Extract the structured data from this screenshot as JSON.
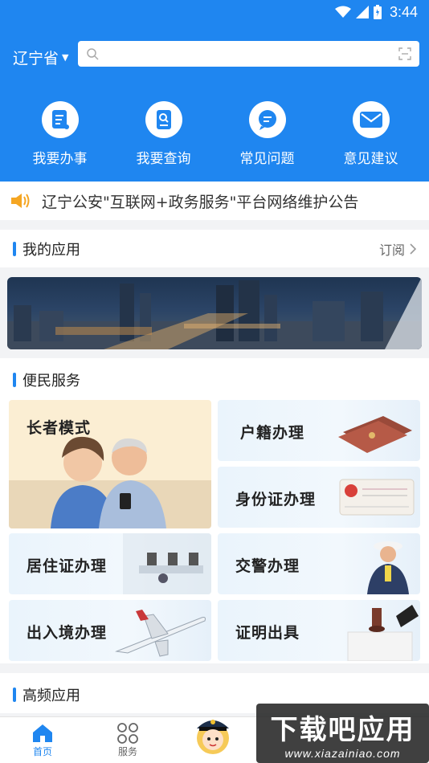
{
  "status_bar": {
    "time": "3:44"
  },
  "header": {
    "province": "辽宁省",
    "search_placeholder": "",
    "quick_actions": [
      {
        "label": "我要办事",
        "icon": "document-icon"
      },
      {
        "label": "我要查询",
        "icon": "search-doc-icon"
      },
      {
        "label": "常见问题",
        "icon": "chat-icon"
      },
      {
        "label": "意见建议",
        "icon": "mail-icon"
      }
    ],
    "colors": {
      "primary": "#1f86f0"
    }
  },
  "notice": {
    "text": "辽宁公安\"互联网+政务服务\"平台网络维护公告",
    "icon": "speaker-icon",
    "icon_color": "#f5a623"
  },
  "my_apps": {
    "title": "我的应用",
    "subscribe": "订阅"
  },
  "services": {
    "title": "便民服务",
    "cards": [
      {
        "label": "长者模式"
      },
      {
        "label": "户籍办理"
      },
      {
        "label": "身份证办理"
      },
      {
        "label": "居住证办理"
      },
      {
        "label": "交警办理"
      },
      {
        "label": "出入境办理"
      },
      {
        "label": "证明出具"
      }
    ]
  },
  "frequent": {
    "title": "高频应用"
  },
  "tabbar": {
    "tabs": [
      {
        "label": "首页",
        "icon": "home-icon",
        "active": true
      },
      {
        "label": "服务",
        "icon": "grid-icon",
        "active": false
      }
    ]
  },
  "watermark": {
    "main": "下载吧应用",
    "sub": "www.xiazainiao.com"
  }
}
